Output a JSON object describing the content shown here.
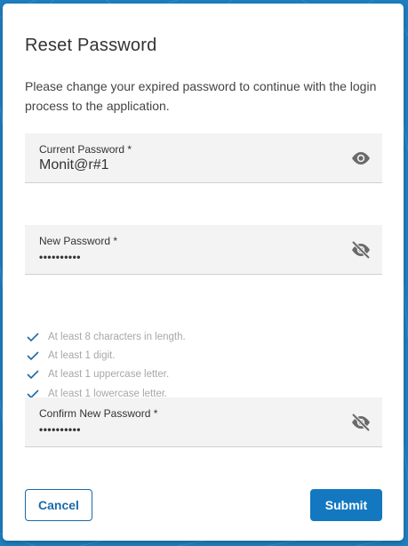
{
  "dialog": {
    "title": "Reset Password",
    "description": "Please change your expired password to continue with the login process to the application."
  },
  "fields": {
    "current": {
      "label": "Current Password *",
      "value": "Monit@r#1",
      "visibility_icon": "eye-icon"
    },
    "new": {
      "label": "New Password *",
      "value": "••••••••••",
      "visibility_icon": "eye-off-icon"
    },
    "confirm": {
      "label": "Confirm New Password *",
      "value": "••••••••••",
      "visibility_icon": "eye-off-icon"
    }
  },
  "requirements": [
    {
      "text": "At least 8 characters in length."
    },
    {
      "text": "At least 1 digit."
    },
    {
      "text": "At least 1 uppercase letter."
    },
    {
      "text": "At least 1 lowercase letter."
    }
  ],
  "buttons": {
    "cancel": "Cancel",
    "submit": "Submit"
  },
  "colors": {
    "background": "#1d7fc0",
    "accent": "#1378c0",
    "check": "#1b6aa8",
    "requirement_text": "#a7a7a7"
  }
}
